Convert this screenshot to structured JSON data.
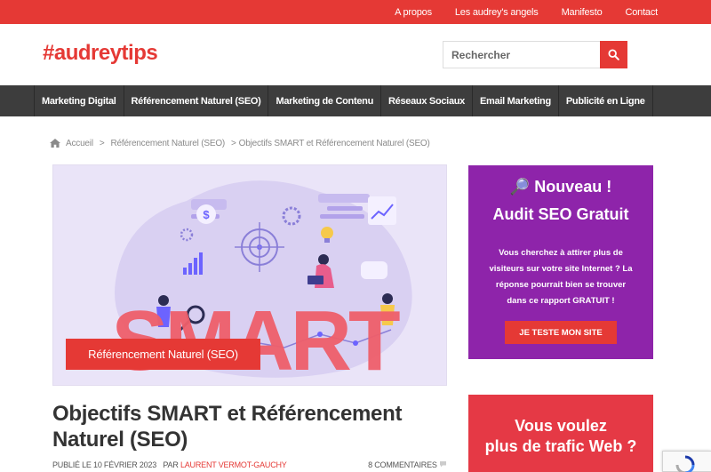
{
  "topbar": {
    "links": [
      "A propos",
      "Les audrey's angels",
      "Manifesto",
      "Contact"
    ]
  },
  "header": {
    "logo": "#audreytips",
    "search_placeholder": "Rechercher"
  },
  "nav": {
    "items": [
      "Marketing Digital",
      "Référencement Naturel (SEO)",
      "Marketing de Contenu",
      "Réseaux Sociaux",
      "Email Marketing",
      "Publicité en Ligne"
    ]
  },
  "breadcrumb": {
    "home": "Accueil",
    "category": "Référencement Naturel (SEO)",
    "current": "Objectifs SMART et Référencement Naturel (SEO)",
    "separator": ">"
  },
  "article": {
    "category_badge": "Référencement Naturel (SEO)",
    "title": "Objectifs SMART et Référencement Naturel (SEO)",
    "published_label": "PUBLIÉ LE 10 FÉVRIER 2023",
    "by_label": "PAR",
    "author": "LAURENT VERMOT-GAUCHY",
    "comments": "8 COMMENTAIRES",
    "image_text": "SMART"
  },
  "sidebar": {
    "promo_title_1": "🔎 Nouveau !",
    "promo_title_2": "Audit SEO Gratuit",
    "promo_desc": "Vous cherchez à attirer plus de visiteurs sur votre site Internet ? La réponse pourrait bien se trouver dans ce rapport GRATUIT !",
    "promo_cta": "JE TESTE MON SITE",
    "traffic_line_1": "Vous voulez",
    "traffic_line_2": "plus de trafic Web ?"
  },
  "colors": {
    "accent": "#e53935",
    "nav_bg": "#3d3d3d",
    "promo_bg": "#8e24aa",
    "traffic_bg": "#e53945"
  }
}
